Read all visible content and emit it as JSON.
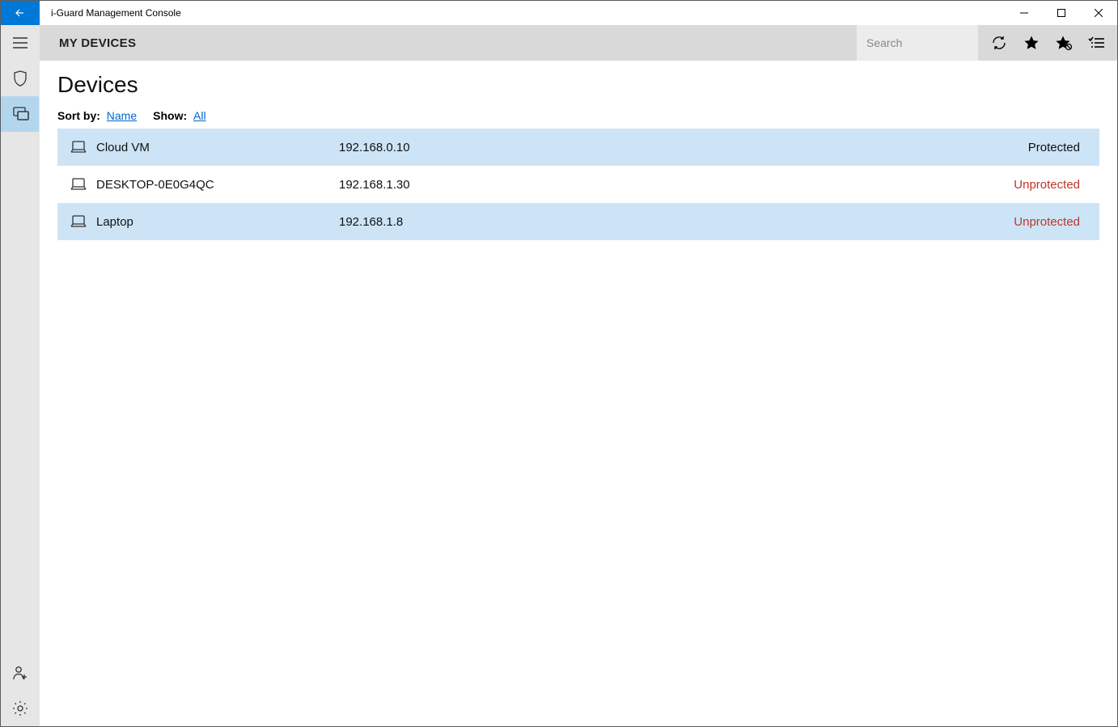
{
  "window": {
    "title": "i-Guard Management Console"
  },
  "toolbar": {
    "title": "MY DEVICES",
    "search_placeholder": "Search"
  },
  "page": {
    "heading": "Devices",
    "sort_label": "Sort by:",
    "sort_value": "Name",
    "show_label": "Show:",
    "show_value": "All"
  },
  "devices": [
    {
      "name": "Cloud VM",
      "ip": "192.168.0.10",
      "status": "Protected",
      "status_class": "status-protected"
    },
    {
      "name": "DESKTOP-0E0G4QC",
      "ip": "192.168.1.30",
      "status": "Unprotected",
      "status_class": "status-unprotected"
    },
    {
      "name": "Laptop",
      "ip": "192.168.1.8",
      "status": "Unprotected",
      "status_class": "status-unprotected"
    }
  ]
}
